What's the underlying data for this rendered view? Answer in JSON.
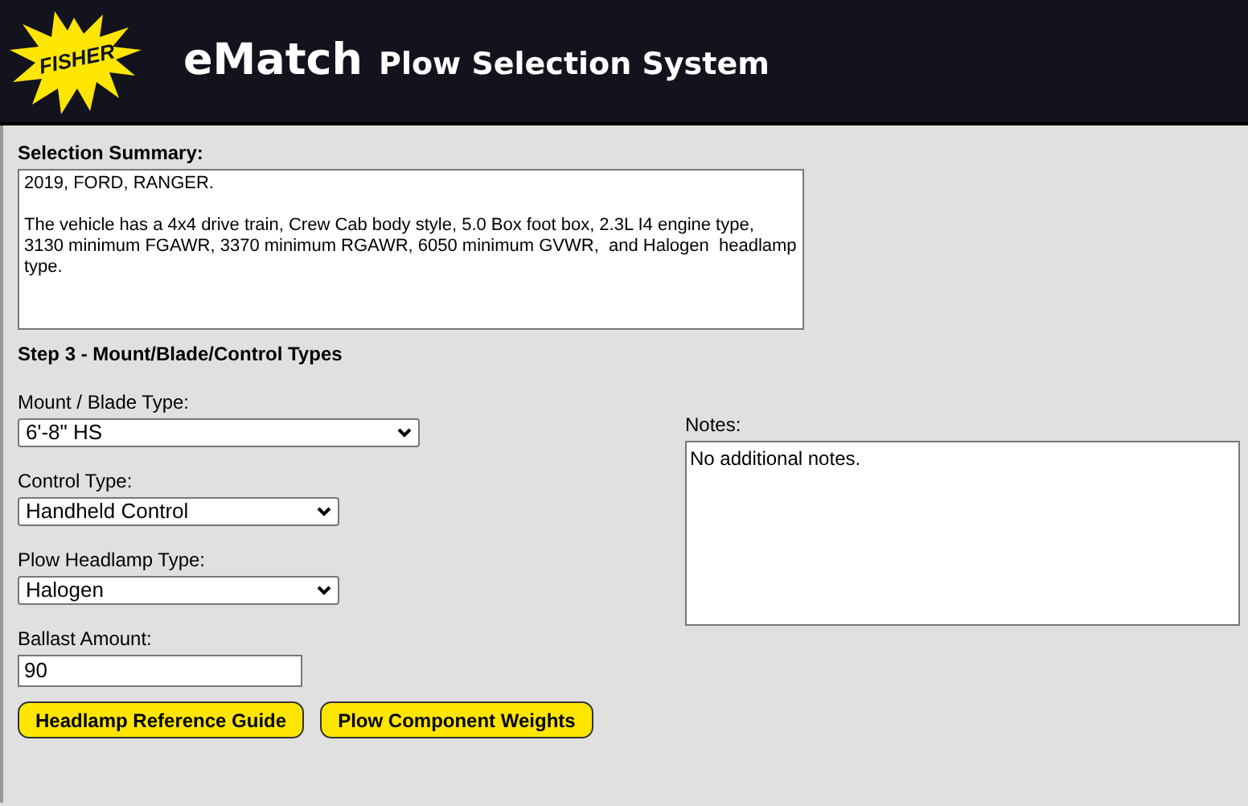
{
  "header": {
    "logo_text": "FISHER",
    "title": "eMatch",
    "subtitle": "Plow Selection System"
  },
  "summary": {
    "label": "Selection Summary:",
    "value": "2019, FORD, RANGER.\n\nThe vehicle has a 4x4 drive train, Crew Cab body style, 5.0 Box foot box, 2.3L I4 engine type, 3130 minimum FGAWR, 3370 minimum RGAWR, 6050 minimum GVWR,  and Halogen  headlamp type."
  },
  "step_heading": "Step 3 - Mount/Blade/Control Types",
  "fields": [
    {
      "kind": "select",
      "label": "Mount / Blade Type:",
      "value": "6'-8\" HS"
    },
    {
      "kind": "select",
      "label": "Control Type:",
      "value": "Handheld Control"
    },
    {
      "kind": "select",
      "label": "Plow Headlamp Type:",
      "value": "Halogen"
    },
    {
      "kind": "text",
      "label": "Ballast Amount:",
      "value": "90"
    }
  ],
  "buttons": [
    "Headlamp Reference Guide",
    "Plow Component Weights"
  ],
  "notes": {
    "label": "Notes:",
    "value": "No additional notes."
  }
}
